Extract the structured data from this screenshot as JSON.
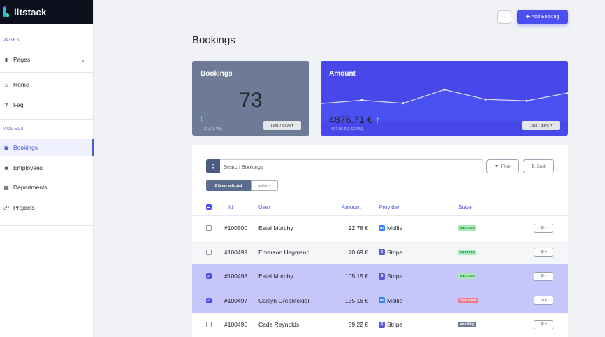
{
  "brand": {
    "name": "litstack"
  },
  "sidebar": {
    "pages_section": "PAGES",
    "models_section": "MODELS",
    "pages_group": {
      "label": "Pages",
      "icon": "file-icon"
    },
    "page_items": [
      {
        "label": "Home",
        "icon": "home-icon"
      },
      {
        "label": "Faq",
        "icon": "question-icon"
      }
    ],
    "model_items": [
      {
        "label": "Bookings",
        "icon": "id-card-icon",
        "active": true
      },
      {
        "label": "Employees",
        "icon": "users-icon",
        "active": false
      },
      {
        "label": "Departments",
        "icon": "building-icon",
        "active": false
      },
      {
        "label": "Projects",
        "icon": "sitemap-icon",
        "active": false
      }
    ]
  },
  "header": {
    "more_label": "···",
    "add_label": "Add Booking",
    "title": "Bookings"
  },
  "stats": {
    "bookings": {
      "title": "Bookings",
      "value": "73",
      "delta": "+1.0 (+1.4%)",
      "period": "Last 7 days ▾"
    },
    "amount": {
      "title": "Amount",
      "value": "4876.71 €",
      "delta": "+601.96 € (+12.3%)",
      "period": "Last 7 days ▾",
      "sparkline": [
        0.12,
        0.24,
        0.13,
        0.62,
        0.27,
        0.22,
        0.5
      ]
    }
  },
  "table": {
    "search_placeholder": "Search Bookings",
    "filter_label": "Filter",
    "sort_label": "Sort",
    "selected_label": "2 items selected",
    "action_label": "action ▾",
    "columns": {
      "id": "Id",
      "user": "User",
      "amount": "Amount",
      "provider": "Provider",
      "state": "State"
    },
    "rows": [
      {
        "id": "#100500",
        "user": "Estel Murphy",
        "amount": "92.78 €",
        "provider": "Mollie",
        "state": "success",
        "checked": false
      },
      {
        "id": "#100499",
        "user": "Emerson Hegmann",
        "amount": "70.69 €",
        "provider": "Stripe",
        "state": "success",
        "checked": false
      },
      {
        "id": "#100498",
        "user": "Estel Murphy",
        "amount": "105.15 €",
        "provider": "Stripe",
        "state": "success",
        "checked": true
      },
      {
        "id": "#100497",
        "user": "Caitlyn Greenfelder",
        "amount": "135.16 €",
        "provider": "Mollie",
        "state": "canceled",
        "checked": true
      },
      {
        "id": "#100496",
        "user": "Cade Reynolds",
        "amount": "59.22 €",
        "provider": "Stripe",
        "state": "pending",
        "checked": false
      }
    ],
    "row_action_label": "⚙ ▾"
  },
  "colors": {
    "accent": "#4b4ff0",
    "bookings_card": "#6d7b97",
    "amount_card": "#4847ea",
    "success_bg": "#a7ecb8",
    "success_fg": "#1f7a3a",
    "canceled_bg": "#f27a8a",
    "canceled_fg": "#ffffff",
    "pending_bg": "#6d7b97",
    "pending_fg": "#ffffff",
    "mollie": "#3b82f6",
    "stripe": "#5b5bd6"
  }
}
